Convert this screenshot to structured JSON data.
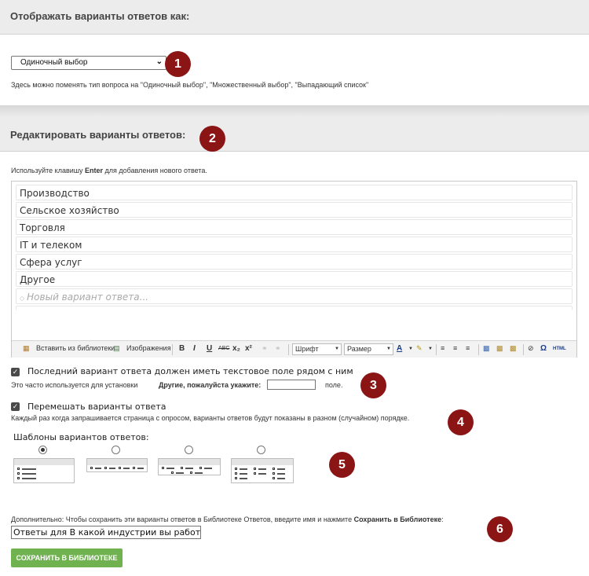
{
  "section1": {
    "title": "Отображать варианты ответов как:",
    "select_value": "Одиночный выбор",
    "note": "Здесь можно поменять тип вопроса на \"Одиночный выбор\", \"Множественный выбор\", \"Выпадающий список\""
  },
  "section2": {
    "title": "Редактировать варианты ответов:",
    "hint_prefix": "Используйте клавишу ",
    "hint_key": "Enter",
    "hint_suffix": " для добавления нового ответа.",
    "answers": [
      "Производство",
      "Сельское хозяйство",
      "Торговля",
      "IT и телеком",
      "Сфера услуг",
      "Другое"
    ],
    "new_answer_placeholder": "Новый вариант ответа..."
  },
  "toolbar": {
    "insert_library": "Вставить из библиотеки",
    "images": "Изображения",
    "bold": "B",
    "italic": "I",
    "underline": "U",
    "strike": "ABC",
    "subscript": "x₂",
    "superscript": "x²",
    "font": "Шрифт",
    "size": "Размер",
    "html": "HTML"
  },
  "other_option": {
    "checked": true,
    "label": "Последний вариант ответа должен иметь текстовое поле рядом с ним",
    "note_prefix": "Это часто используется для установки",
    "note_bold": "Другие, пожалуйста укажите:",
    "note_suffix": "поле."
  },
  "shuffle": {
    "checked": true,
    "label": "Перемешать варианты ответа",
    "note": "Каждый раз когда запрашивается страница с опросом, варианты ответов будут показаны в разном (случайном) порядке."
  },
  "templates": {
    "title": "Шаблоны вариантов ответов:",
    "selected_index": 0
  },
  "library": {
    "note_prefix": "Дополнительно: Чтобы сохранить эти варианты ответов в Библиотеке Ответов, введите имя и нажмите ",
    "note_bold": "Сохранить в Библиотеке",
    "note_suffix": ":",
    "input_value": "Ответы для В какой индустрии вы работаете?В",
    "save_label": "СОХРАНИТЬ В БИБЛИОТЕКЕ"
  },
  "badges": [
    "1",
    "2",
    "3",
    "4",
    "5",
    "6"
  ],
  "colors": {
    "badge": "#8b1414",
    "save_button": "#6fb24f",
    "section_header": "#ececec"
  }
}
